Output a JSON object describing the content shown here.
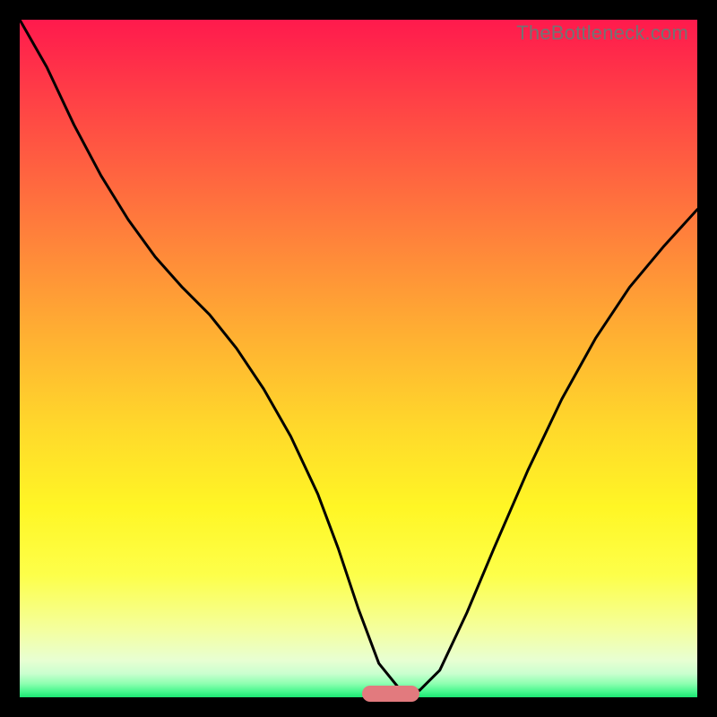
{
  "watermark": "TheBottleneck.com",
  "gradient_stops": [
    {
      "offset": 0.0,
      "color": "#ff1a4d"
    },
    {
      "offset": 0.05,
      "color": "#ff2a4a"
    },
    {
      "offset": 0.15,
      "color": "#ff4b44"
    },
    {
      "offset": 0.3,
      "color": "#ff7b3c"
    },
    {
      "offset": 0.45,
      "color": "#ffab33"
    },
    {
      "offset": 0.6,
      "color": "#ffd82b"
    },
    {
      "offset": 0.72,
      "color": "#fff625"
    },
    {
      "offset": 0.82,
      "color": "#fdff4a"
    },
    {
      "offset": 0.9,
      "color": "#f4ff9e"
    },
    {
      "offset": 0.945,
      "color": "#e8ffd2"
    },
    {
      "offset": 0.965,
      "color": "#caffcf"
    },
    {
      "offset": 0.98,
      "color": "#8dffb0"
    },
    {
      "offset": 0.992,
      "color": "#45f78d"
    },
    {
      "offset": 1.0,
      "color": "#1be573"
    }
  ],
  "curve_color": "#000000",
  "curve_width": 3,
  "marker": {
    "color": "#e27a7e",
    "x_center": 0.548,
    "width_frac": 0.085,
    "y": 0.995,
    "height_frac": 0.024,
    "radius": 9
  },
  "chart_data": {
    "type": "line",
    "title": "",
    "xlabel": "",
    "ylabel": "",
    "xlim": [
      0,
      1
    ],
    "ylim": [
      0,
      1
    ],
    "grid": false,
    "series": [
      {
        "name": "bottleneck-curve",
        "x": [
          0.0,
          0.04,
          0.08,
          0.12,
          0.16,
          0.2,
          0.24,
          0.28,
          0.32,
          0.36,
          0.4,
          0.44,
          0.47,
          0.5,
          0.53,
          0.56,
          0.59,
          0.62,
          0.66,
          0.7,
          0.75,
          0.8,
          0.85,
          0.9,
          0.95,
          1.0
        ],
        "y": [
          1.0,
          0.93,
          0.845,
          0.77,
          0.705,
          0.65,
          0.605,
          0.565,
          0.515,
          0.455,
          0.385,
          0.3,
          0.22,
          0.13,
          0.05,
          0.013,
          0.01,
          0.04,
          0.125,
          0.22,
          0.335,
          0.44,
          0.53,
          0.605,
          0.665,
          0.72
        ]
      }
    ],
    "annotations": [
      {
        "type": "marker-pill",
        "x_center": 0.548,
        "width": 0.085,
        "y": 0.005
      }
    ]
  }
}
